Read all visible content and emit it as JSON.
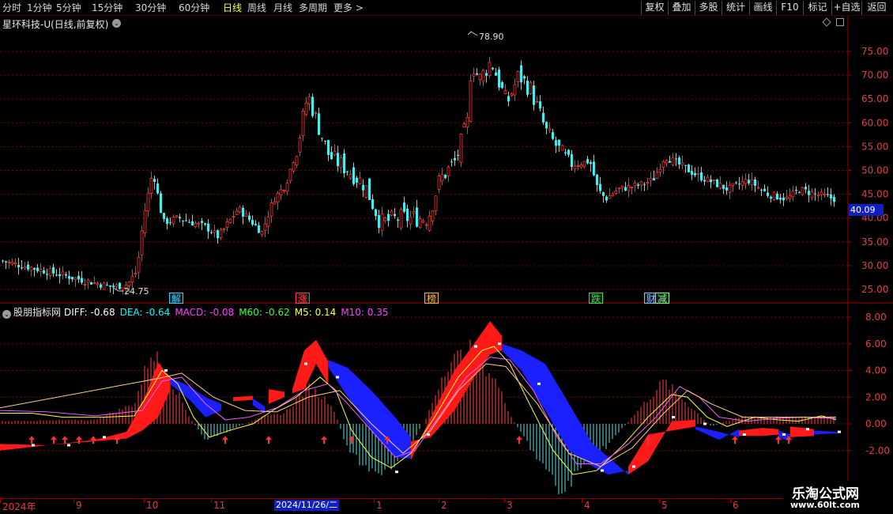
{
  "toolbar": {
    "periods": [
      "分时",
      "1分钟",
      "5分钟",
      "15分钟",
      "30分钟",
      "60分钟",
      "日线",
      "周线",
      "月线",
      "多周期",
      "更多 >"
    ],
    "active_period": "日线",
    "tools": [
      "复权",
      "叠加",
      "多股",
      "统计",
      "画线",
      "F10",
      "标记",
      "+自选",
      "返回"
    ]
  },
  "stock": {
    "name": "星环科技-U(日线,前复权)",
    "high_marker": "78.90",
    "low_marker": "24.75",
    "current_price": "40.09"
  },
  "price_axis": {
    "labels": [
      "75.00",
      "70.00",
      "65.00",
      "60.00",
      "55.00",
      "50.00",
      "45.00",
      "40.00",
      "35.00",
      "30.00",
      "25.00"
    ]
  },
  "events": [
    {
      "label": "解",
      "color": "#40d0ff"
    },
    {
      "label": "涨",
      "color": "#ff4040"
    },
    {
      "label": "榜",
      "color": "#ffb030"
    },
    {
      "label": "跌",
      "color": "#40e040"
    },
    {
      "label": "财",
      "color": "#80c0ff"
    },
    {
      "label": "减",
      "color": "#80ff80"
    }
  ],
  "indicator": {
    "name": "股朋指标网",
    "diff": "DIFF: -0.68",
    "dea": "DEA: -0.64",
    "macd": "MACD: -0.08",
    "m60": "M60: -0.62",
    "m5": "M5: 0.14",
    "m10": "M10: 0.35",
    "colors": {
      "diff": "#ffffff",
      "dea": "#00ffff",
      "macd": "#ff40ff",
      "m60": "#40ff40",
      "m5": "#ffff40",
      "m10": "#ff40ff"
    },
    "axis_labels": [
      "8.00",
      "6.00",
      "4.00",
      "2.00",
      "0.00",
      "-2.00"
    ]
  },
  "date_axis": {
    "ticks": [
      "2024年",
      "9",
      "10",
      "11",
      "1",
      "2",
      "3",
      "4",
      "5",
      "6"
    ],
    "cursor": "2024/11/26/二"
  },
  "watermark": {
    "title": "乐淘公式网",
    "url": "www.60lt.com"
  },
  "chart_data": {
    "type": "candlestick",
    "title": "星环科技-U(日线,前复权)",
    "y_range": [
      23,
      79
    ],
    "y_ticks": [
      25,
      30,
      35,
      40,
      45,
      50,
      55,
      60,
      65,
      70,
      75
    ],
    "period_max": 78.9,
    "period_min": 24.75,
    "last_price": 40.09,
    "approx_close_path": [
      {
        "x": "2024-08",
        "y": 31
      },
      {
        "x": "2024-09",
        "y": 27
      },
      {
        "x": "2024-09-24",
        "y": 25
      },
      {
        "x": "2024-10-08",
        "y": 50
      },
      {
        "x": "2024-10-15",
        "y": 39
      },
      {
        "x": "2024-11-01",
        "y": 42
      },
      {
        "x": "2024-11-20",
        "y": 67
      },
      {
        "x": "2024-12-15",
        "y": 50
      },
      {
        "x": "2025-01-10",
        "y": 40
      },
      {
        "x": "2025-02-10",
        "y": 52
      },
      {
        "x": "2025-02-25",
        "y": 75
      },
      {
        "x": "2025-03-10",
        "y": 70
      },
      {
        "x": "2025-03-31",
        "y": 52
      },
      {
        "x": "2025-04-08",
        "y": 44
      },
      {
        "x": "2025-05-15",
        "y": 54
      },
      {
        "x": "2025-06-10",
        "y": 46
      },
      {
        "x": "2025-06-30",
        "y": 44
      }
    ],
    "indicator_panel": {
      "y_range": [
        -3.5,
        9
      ],
      "y_ticks": [
        8,
        6,
        4,
        2,
        0,
        -2
      ]
    }
  }
}
